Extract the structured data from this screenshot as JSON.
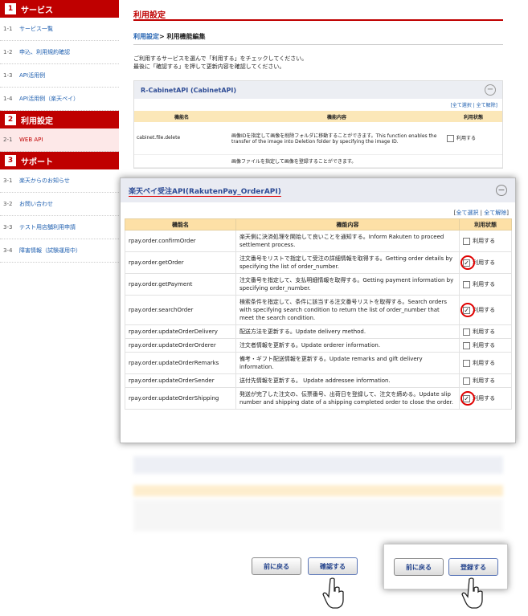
{
  "sidebar": {
    "sections": [
      {
        "num": "1",
        "title": "サービス",
        "items": [
          {
            "num": "1-1",
            "label": "サービス一覧"
          },
          {
            "num": "1-2",
            "label": "申込、利用規約確認"
          },
          {
            "num": "1-3",
            "label": "API活用例"
          },
          {
            "num": "1-4",
            "label": "API活用例（楽天ペイ）"
          }
        ]
      },
      {
        "num": "2",
        "title": "利用設定",
        "items": [
          {
            "num": "2-1",
            "label": "WEB API"
          }
        ]
      },
      {
        "num": "3",
        "title": "サポート",
        "items": [
          {
            "num": "3-1",
            "label": "楽天からのお知らせ"
          },
          {
            "num": "3-2",
            "label": "お問い合わせ"
          },
          {
            "num": "3-3",
            "label": "テスト用店舗利用申請"
          },
          {
            "num": "3-4",
            "label": "障害情報（試験運用中）"
          }
        ]
      }
    ]
  },
  "main": {
    "title": "利用設定",
    "breadcrumb_link": "利用設定",
    "breadcrumb_sep": "> ",
    "breadcrumb_current": "利用機能編集",
    "intro_line1": "ご利用するサービスを選んで「利用する」をチェックしてください。",
    "intro_line2": "最後に「確認する」を押して更新内容を確認してください。",
    "bg_section_title": "R-CabinetAPI (CabinetAPI)",
    "bg_links": "[全て選択 | 全て解除]",
    "bg_headers": [
      "機能名",
      "機能内容",
      "利用状態"
    ],
    "bg_row_name": "cabinet.file.delete",
    "bg_row_desc": "画像IDを指定して画像を削除フォルダに移動することができます。This function enables the transfer of the image into Deletion folder by specifying the image ID.",
    "bg_row_status": "利用する",
    "bg_row2_desc": "画像ファイルを指定して画像を登録することができます。"
  },
  "overlay": {
    "title": "楽天ペイ受注API(RakutenPay_OrderAPI)",
    "links_open": "[",
    "select_all": "全て選択",
    "links_sep": " | ",
    "deselect_all": "全て解除",
    "links_close": "]",
    "headers": [
      "機能名",
      "機能内容",
      "利用状態"
    ],
    "rows": [
      {
        "name": "rpay.order.confirmOrder",
        "desc": "楽天側に決済処理を開始して良いことを通知する。Inform Rakuten to proceed settlement process.",
        "status": "利用する",
        "checked": false
      },
      {
        "name": "rpay.order.getOrder",
        "desc": "注文番号をリストで指定して受注の詳細情報を取得する。Getting order details by specifying the list of order_number.",
        "status": "利用する",
        "checked": true
      },
      {
        "name": "rpay.order.getPayment",
        "desc": "注文番号を指定して、支払明細情報を取得する。Getting payment information by specifying order_number.",
        "status": "利用する",
        "checked": false
      },
      {
        "name": "rpay.order.searchOrder",
        "desc": "検索条件を指定して、条件に該当する注文番号リストを取得する。Search orders with specifying search condition to return the list of order_number that meet the search condition.",
        "status": "利用する",
        "checked": true
      },
      {
        "name": "rpay.order.updateOrderDelivery",
        "desc": "配送方法を更新する。Update delivery method.",
        "status": "利用する",
        "checked": false
      },
      {
        "name": "rpay.order.updateOrderOrderer",
        "desc": "注文者情報を更新する。Update orderer information.",
        "status": "利用する",
        "checked": false
      },
      {
        "name": "rpay.order.updateOrderRemarks",
        "desc": "備考・ギフト配送情報を更新する。Update remarks and gift delivery information.",
        "status": "利用する",
        "checked": false
      },
      {
        "name": "rpay.order.updateOrderSender",
        "desc": "送付先情報を更新する。 Update addressee information.",
        "status": "利用する",
        "checked": false
      },
      {
        "name": "rpay.order.updateOrderShipping",
        "desc": "発送が完了した注文の、伝票番号、出荷日を登録して、注文を締める。Update slip number and shipping date of a shipping completed order to close the order.",
        "status": "利用する",
        "checked": true
      }
    ]
  },
  "buttons": {
    "back": "前に戻る",
    "confirm": "確認する",
    "back2": "前に戻る",
    "register": "登録する"
  },
  "colors": {
    "accent": "#bf0000",
    "link": "#2060b0",
    "header_bg": "#fde0a6",
    "highlight": "#e00000"
  }
}
